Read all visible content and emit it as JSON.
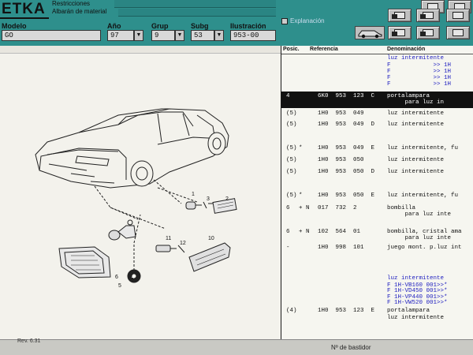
{
  "app": {
    "logo": "ETKA",
    "menu_line1": "Restricciones",
    "menu_line2": "Albarán de material",
    "status_left": "Rev. 6.31",
    "status_right": "Nº de bastidor",
    "checkbox_label": "Explanación"
  },
  "fields": {
    "modelo_label": "Modelo",
    "modelo_value": "GO",
    "ano_label": "Año",
    "ano_value": "97",
    "grup_label": "Grup",
    "grup_value": "9",
    "subg_label": "Subg",
    "subg_value": "53",
    "ilustracion_label": "Ilustración",
    "ilustracion_value": "953-00"
  },
  "list": {
    "header_pos": "Posic.",
    "header_ref": "Referencia",
    "header_denom": "Denominación",
    "rows": [
      {
        "pos": "",
        "mark": "",
        "ref": "",
        "denom": "luz intermitente",
        "blue": true
      },
      {
        "pos": "",
        "mark": "",
        "ref": "",
        "denom": "F            >> 1H",
        "blue": true
      },
      {
        "pos": "",
        "mark": "",
        "ref": "",
        "denom": "F            >> 1H",
        "blue": true
      },
      {
        "pos": "",
        "mark": "",
        "ref": "",
        "denom": "F            >> 1H",
        "blue": true
      },
      {
        "pos": "",
        "mark": "",
        "ref": "",
        "denom": "F            >> 1H",
        "blue": true
      },
      {
        "pos": "4",
        "mark": "",
        "ref": "6K0  953  123  C",
        "denom": "portalampara",
        "sel": true
      },
      {
        "pos": "",
        "mark": "",
        "ref": "",
        "denom": "     para luz in",
        "sel": true
      },
      {
        "pos": "(5)",
        "mark": "",
        "ref": "1H0  953  049",
        "denom": "luz intermitente"
      },
      {
        "pos": "(5)",
        "mark": "",
        "ref": "1H0  953  049  D",
        "denom": "luz intermitente"
      },
      {
        "pos": "(5)",
        "mark": "*",
        "ref": "1H0  953  049  E",
        "denom": "luz intermitente, fu"
      },
      {
        "pos": "(5)",
        "mark": "",
        "ref": "1H0  953  050",
        "denom": "luz intermitente"
      },
      {
        "pos": "(5)",
        "mark": "",
        "ref": "1H0  953  050  D",
        "denom": "luz intermitente"
      },
      {
        "pos": "(5)",
        "mark": "*",
        "ref": "1H0  953  050  E",
        "denom": "luz intermitente, fu"
      },
      {
        "pos": "6",
        "mark": "+ N",
        "ref": "017  732  2",
        "denom": "bombilla"
      },
      {
        "pos": "",
        "mark": "",
        "ref": "",
        "denom": "     para luz inte"
      },
      {
        "pos": "6",
        "mark": "+ N",
        "ref": "102  564  01",
        "denom": "bombilla, cristal ama"
      },
      {
        "pos": "",
        "mark": "",
        "ref": "",
        "denom": "     para luz inte"
      },
      {
        "pos": "-",
        "mark": "",
        "ref": "1H0  998  101",
        "denom": "juego mont. p.luz int"
      },
      {
        "pos": "",
        "mark": "",
        "ref": "",
        "denom": "luz intermitente",
        "blue": true
      },
      {
        "pos": "",
        "mark": "",
        "ref": "",
        "denom": "F 1H-VB160 001>>*",
        "blue": true
      },
      {
        "pos": "",
        "mark": "",
        "ref": "",
        "denom": "F 1H-VD450 001>>*",
        "blue": true
      },
      {
        "pos": "",
        "mark": "",
        "ref": "",
        "denom": "F 1H-VP440 001>>*",
        "blue": true
      },
      {
        "pos": "",
        "mark": "",
        "ref": "",
        "denom": "F 1H-VW520 001>>*",
        "blue": true
      },
      {
        "pos": "(4)",
        "mark": "",
        "ref": "1H0  953  123  E",
        "denom": "portalampara"
      },
      {
        "pos": "",
        "mark": "",
        "ref": "",
        "denom": "luz intermitente"
      }
    ]
  },
  "diagram_callouts": [
    "1",
    "2",
    "3",
    "4",
    "5",
    "6",
    "10",
    "11",
    "12"
  ],
  "colors": {
    "header_teal": "#2e8f8c",
    "panel_bg": "#f3f2ec",
    "selected_row": "#111111",
    "blue_text": "#2020c0"
  }
}
